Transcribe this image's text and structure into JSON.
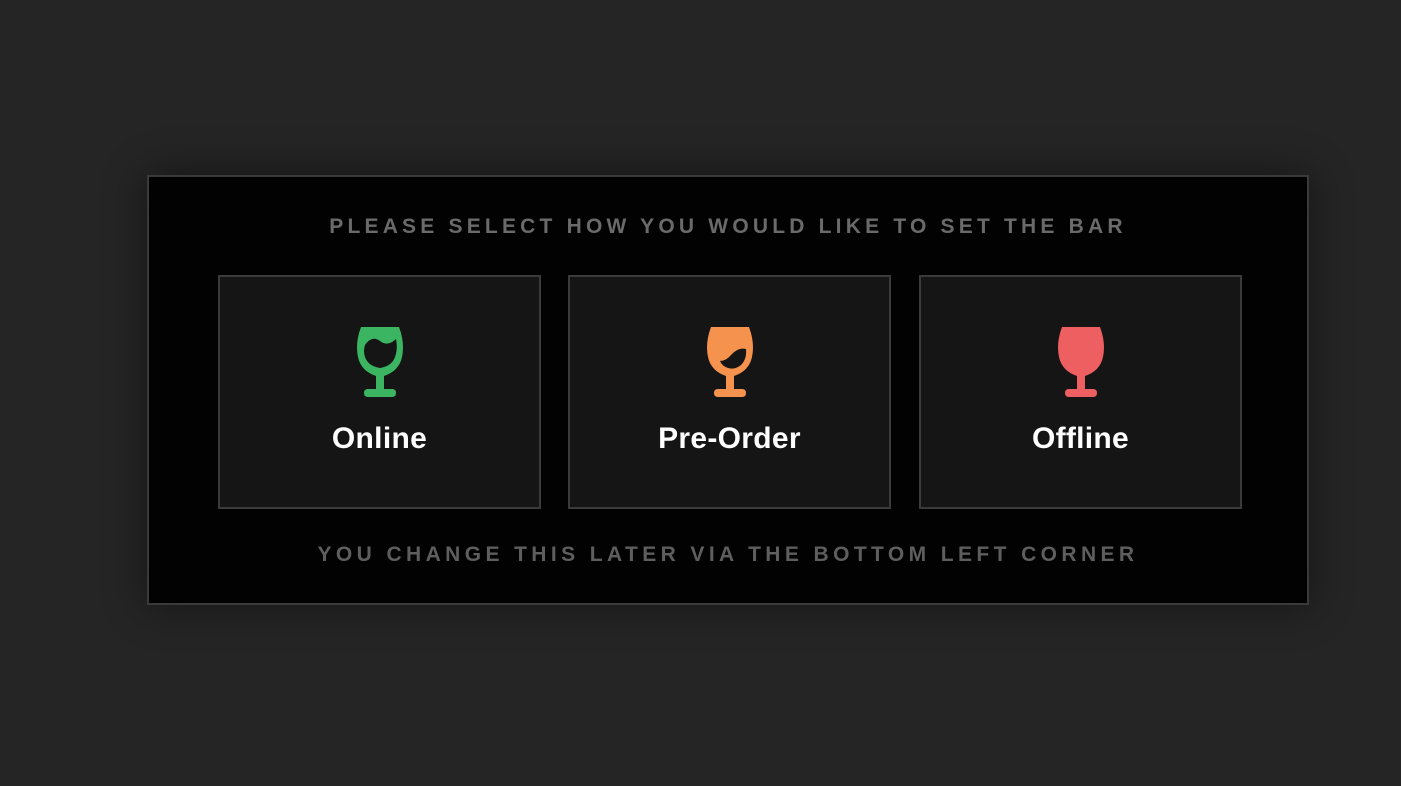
{
  "dialog": {
    "title": "PLEASE SELECT HOW YOU WOULD LIKE TO SET THE BAR",
    "footer": "YOU CHANGE THIS LATER VIA THE BOTTOM LEFT CORNER"
  },
  "options": [
    {
      "label": "Online",
      "icon": "wine-glass-icon",
      "color": "#3cb563"
    },
    {
      "label": "Pre-Order",
      "icon": "wine-glass-icon",
      "color": "#f5924e"
    },
    {
      "label": "Offline",
      "icon": "wine-glass-icon",
      "color": "#ee5f62"
    }
  ],
  "colors": {
    "background": "#252525",
    "modal": "#020202",
    "card": "#151515",
    "border": "#3b3b3b"
  }
}
